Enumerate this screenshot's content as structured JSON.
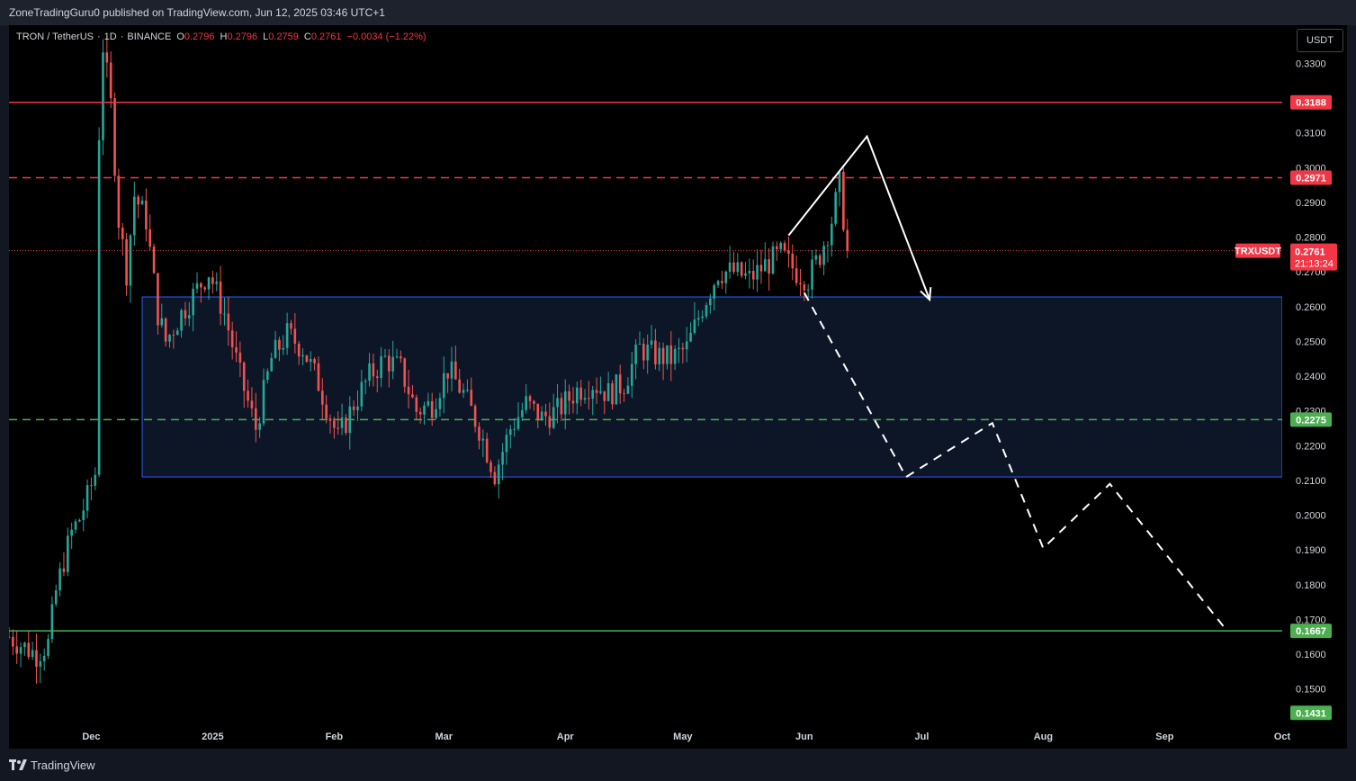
{
  "header": {
    "published_text": "ZoneTradingGuru0 published on TradingView.com, Jun 12, 2025 03:46 UTC+1"
  },
  "legend": {
    "symbol": "TRON / TetherUS",
    "interval": "1D",
    "exchange": "BINANCE",
    "o_label": "O",
    "o_value": "0.2796",
    "h_label": "H",
    "h_value": "0.2796",
    "l_label": "L",
    "l_value": "0.2759",
    "c_label": "C",
    "c_value": "0.2761",
    "change": "−0.0034 (−1.22%)"
  },
  "currency_button": "USDT",
  "footer": {
    "brand": "TradingView"
  },
  "colors": {
    "background": "#000000",
    "bull": "#26a69a",
    "bear": "#ef5350",
    "resistance": "#f23645",
    "support": "#4caf50",
    "zone_border": "#2962ff",
    "zone_fill": "#0d1626",
    "projection": "#ffffff"
  },
  "chart_data": {
    "type": "candlestick",
    "symbol": "TRXUSDT",
    "x_axis_labels": [
      "Dec",
      "2025",
      "Feb",
      "Mar",
      "Apr",
      "May",
      "Jun",
      "Jul",
      "Aug",
      "Sep",
      "Oct"
    ],
    "x_axis_dates": [
      "2024-12-01",
      "2025-01-01",
      "2025-02-01",
      "2025-03-01",
      "2025-04-01",
      "2025-05-01",
      "2025-06-01",
      "2025-07-01",
      "2025-08-01",
      "2025-09-01",
      "2025-10-01"
    ],
    "y_ticks": [
      "0.3300",
      "0.3100",
      "0.3000",
      "0.2900",
      "0.2800",
      "0.2700",
      "0.2600",
      "0.2500",
      "0.2400",
      "0.2300",
      "0.2200",
      "0.2100",
      "0.2000",
      "0.1900",
      "0.1800",
      "0.1700",
      "0.1600",
      "0.1500"
    ],
    "y_range": [
      0.138,
      0.341
    ],
    "x_range": [
      "2024-11-10",
      "2025-10-01"
    ],
    "levels": [
      {
        "price": 0.3188,
        "label": "0.3188",
        "style": "solid",
        "color": "#f23645"
      },
      {
        "price": 0.2971,
        "label": "0.2971",
        "style": "dashed",
        "color": "#f23645"
      },
      {
        "price": 0.2275,
        "label": "0.2275",
        "style": "dashed",
        "color": "#4caf50"
      },
      {
        "price": 0.1667,
        "label": "0.1667",
        "style": "solid",
        "color": "#4caf50"
      }
    ],
    "bottom_label": {
      "label": "0.1431",
      "color": "#4caf50"
    },
    "current_price": {
      "label": "0.2761",
      "symbol_label": "TRXUSDT",
      "countdown": "21:13:24"
    },
    "zone": {
      "top": 0.2628,
      "bottom": 0.211,
      "start": "2024-12-14",
      "end": "2025-10-01"
    },
    "projection_solid": [
      {
        "date": "2025-05-28",
        "price": 0.2805
      },
      {
        "date": "2025-06-17",
        "price": 0.309
      },
      {
        "date": "2025-07-03",
        "price": 0.262
      }
    ],
    "projection_dashed": [
      {
        "date": "2025-06-01",
        "price": 0.264
      },
      {
        "date": "2025-06-27",
        "price": 0.211
      },
      {
        "date": "2025-07-19",
        "price": 0.2265
      },
      {
        "date": "2025-08-01",
        "price": 0.1905
      },
      {
        "date": "2025-08-18",
        "price": 0.209
      },
      {
        "date": "2025-09-16",
        "price": 0.168
      }
    ],
    "series_path": [
      [
        "2024-11-10",
        0.165
      ],
      [
        "2024-11-14",
        0.162
      ],
      [
        "2024-11-17",
        0.16
      ],
      [
        "2024-11-20",
        0.163
      ],
      [
        "2024-11-22",
        0.178
      ],
      [
        "2024-11-24",
        0.187
      ],
      [
        "2024-11-26",
        0.195
      ],
      [
        "2024-11-28",
        0.199
      ],
      [
        "2024-11-30",
        0.205
      ],
      [
        "2024-12-02",
        0.212
      ],
      [
        "2024-12-03",
        0.31
      ],
      [
        "2024-12-04",
        0.335
      ],
      [
        "2024-12-06",
        0.318
      ],
      [
        "2024-12-08",
        0.285
      ],
      [
        "2024-12-10",
        0.27
      ],
      [
        "2024-12-12",
        0.292
      ],
      [
        "2024-12-15",
        0.285
      ],
      [
        "2024-12-18",
        0.258
      ],
      [
        "2024-12-20",
        0.25
      ],
      [
        "2024-12-24",
        0.258
      ],
      [
        "2024-12-28",
        0.265
      ],
      [
        "2024-12-31",
        0.27
      ],
      [
        "2025-01-04",
        0.258
      ],
      [
        "2025-01-08",
        0.24
      ],
      [
        "2025-01-12",
        0.225
      ],
      [
        "2025-01-16",
        0.245
      ],
      [
        "2025-01-20",
        0.252
      ],
      [
        "2025-01-24",
        0.248
      ],
      [
        "2025-01-28",
        0.238
      ],
      [
        "2025-02-02",
        0.222
      ],
      [
        "2025-02-06",
        0.232
      ],
      [
        "2025-02-10",
        0.24
      ],
      [
        "2025-02-14",
        0.245
      ],
      [
        "2025-02-18",
        0.242
      ],
      [
        "2025-02-22",
        0.23
      ],
      [
        "2025-02-26",
        0.232
      ],
      [
        "2025-03-02",
        0.242
      ],
      [
        "2025-03-06",
        0.235
      ],
      [
        "2025-03-10",
        0.225
      ],
      [
        "2025-03-14",
        0.212
      ],
      [
        "2025-03-18",
        0.225
      ],
      [
        "2025-03-22",
        0.232
      ],
      [
        "2025-03-26",
        0.228
      ],
      [
        "2025-03-30",
        0.23
      ],
      [
        "2025-04-04",
        0.236
      ],
      [
        "2025-04-08",
        0.238
      ],
      [
        "2025-04-12",
        0.235
      ],
      [
        "2025-04-16",
        0.238
      ],
      [
        "2025-04-20",
        0.248
      ],
      [
        "2025-04-24",
        0.246
      ],
      [
        "2025-04-28",
        0.245
      ],
      [
        "2025-05-02",
        0.248
      ],
      [
        "2025-05-06",
        0.26
      ],
      [
        "2025-05-10",
        0.27
      ],
      [
        "2025-05-14",
        0.27
      ],
      [
        "2025-05-18",
        0.268
      ],
      [
        "2025-05-22",
        0.272
      ],
      [
        "2025-05-26",
        0.275
      ],
      [
        "2025-05-30",
        0.27
      ],
      [
        "2025-06-02",
        0.268
      ],
      [
        "2025-06-05",
        0.275
      ],
      [
        "2025-06-08",
        0.285
      ],
      [
        "2025-06-10",
        0.295
      ],
      [
        "2025-06-12",
        0.2761
      ]
    ],
    "grid": false,
    "legend_position": "top-left"
  }
}
